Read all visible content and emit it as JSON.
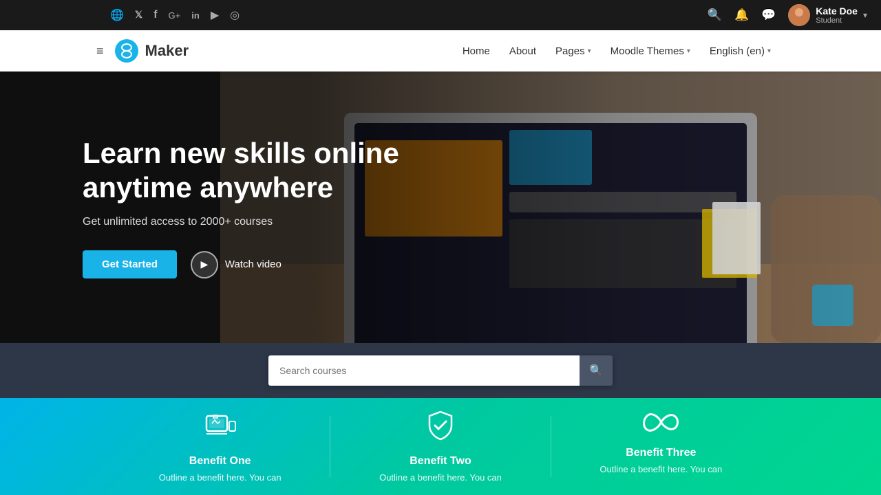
{
  "topbar": {
    "social_icons": [
      {
        "name": "globe-icon",
        "symbol": "🌐"
      },
      {
        "name": "twitter-icon",
        "symbol": "𝕏"
      },
      {
        "name": "facebook-icon",
        "symbol": "f"
      },
      {
        "name": "google-plus-icon",
        "symbol": "G+"
      },
      {
        "name": "linkedin-icon",
        "symbol": "in"
      },
      {
        "name": "youtube-icon",
        "symbol": "▶"
      },
      {
        "name": "instagram-icon",
        "symbol": "◎"
      }
    ],
    "action_icons": [
      {
        "name": "search-icon",
        "symbol": "🔍"
      },
      {
        "name": "notification-icon",
        "symbol": "🔔"
      },
      {
        "name": "message-icon",
        "symbol": "💬"
      }
    ],
    "user": {
      "name": "Kate Doe",
      "role": "Student"
    }
  },
  "nav": {
    "logo_text": "Maker",
    "links": [
      {
        "label": "Home",
        "name": "home-link"
      },
      {
        "label": "About",
        "name": "about-link"
      },
      {
        "label": "Pages",
        "name": "pages-link",
        "has_dropdown": true
      },
      {
        "label": "Moodle Themes",
        "name": "moodle-themes-link",
        "has_dropdown": true
      },
      {
        "label": "English (en)",
        "name": "language-link",
        "has_dropdown": true
      }
    ]
  },
  "hero": {
    "title_line1": "Learn new skills online",
    "title_line2": "anytime anywhere",
    "subtitle": "Get unlimited access to 2000+ courses",
    "cta_label": "Get Started",
    "watch_video_label": "Watch video"
  },
  "search": {
    "placeholder": "Search courses"
  },
  "benefits": [
    {
      "icon_name": "device-benefit-icon",
      "title": "Benefit One",
      "description": "Outline a benefit here. You can"
    },
    {
      "icon_name": "shield-benefit-icon",
      "title": "Benefit Two",
      "description": "Outline a benefit here. You can"
    },
    {
      "icon_name": "infinity-benefit-icon",
      "title": "Benefit Three",
      "description": "Outline a benefit here. You can"
    }
  ]
}
